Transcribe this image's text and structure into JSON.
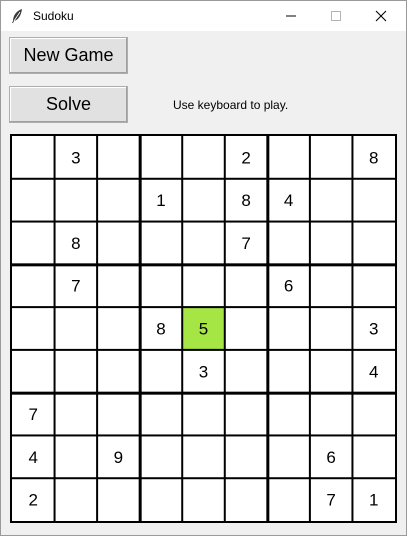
{
  "window": {
    "title": "Sudoku",
    "controls": {
      "minimize": "minimize-icon",
      "maximize": "maximize-icon",
      "close": "close-icon"
    }
  },
  "toolbar": {
    "new_game_label": "New Game",
    "solve_label": "Solve",
    "hint": "Use keyboard to play."
  },
  "board": {
    "selected": {
      "row": 4,
      "col": 4
    },
    "selected_color": "#a5e645",
    "cells": [
      [
        "",
        "3",
        "",
        "",
        "",
        "2",
        "",
        "",
        "8"
      ],
      [
        "",
        "",
        "",
        "1",
        "",
        "8",
        "4",
        "",
        ""
      ],
      [
        "",
        "8",
        "",
        "",
        "",
        "7",
        "",
        "",
        ""
      ],
      [
        "",
        "7",
        "",
        "",
        "",
        "",
        "6",
        "",
        ""
      ],
      [
        "",
        "",
        "",
        "8",
        "5",
        "",
        "",
        "",
        "3"
      ],
      [
        "",
        "",
        "",
        "",
        "3",
        "",
        "",
        "",
        "4"
      ],
      [
        "7",
        "",
        "",
        "",
        "",
        "",
        "",
        "",
        ""
      ],
      [
        "4",
        "",
        "9",
        "",
        "",
        "",
        "",
        "6",
        ""
      ],
      [
        "2",
        "",
        "",
        "",
        "",
        "",
        "",
        "7",
        "1"
      ]
    ]
  }
}
